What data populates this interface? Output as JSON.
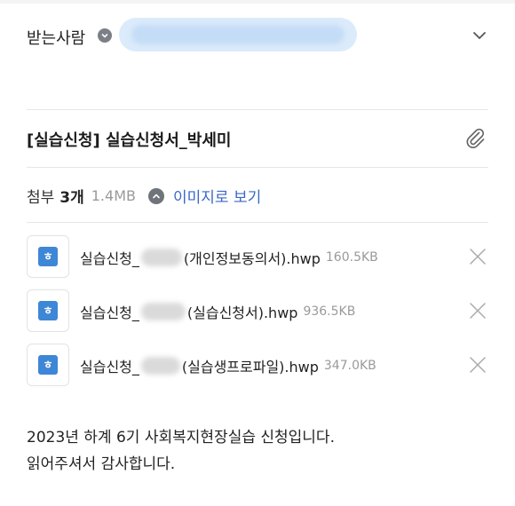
{
  "recipient": {
    "label": "받는사람",
    "info_icon": "info-circle-icon",
    "expand_icon": "chevron-down-icon"
  },
  "subject": {
    "text": "[실습신청] 실습신청서_박세미",
    "attach_icon": "paperclip-icon"
  },
  "attachments_summary": {
    "label": "첨부",
    "count": "3개",
    "total_size": "1.4MB",
    "collapse_icon": "chevron-up-circle-icon",
    "image_view_label": "이미지로 보기"
  },
  "attachments": [
    {
      "prefix": "실습신청_",
      "suffix": "(개인정보동의서).hwp",
      "size": "160.5KB",
      "icon": "hwp-file-icon",
      "icon_glyph": "ㅎ"
    },
    {
      "prefix": "실습신청_",
      "suffix": "(실습신청서).hwp",
      "size": "936.5KB",
      "icon": "hwp-file-icon",
      "icon_glyph": "ㅎ"
    },
    {
      "prefix": "실습신청_",
      "suffix": " (실습생프로파일).hwp",
      "size": "347.0KB",
      "icon": "hwp-file-icon",
      "icon_glyph": "ㅎ"
    }
  ],
  "body": {
    "line1": "2023년 하계 6기 사회복지현장실습 신청입니다.",
    "line2": "읽어주셔서 감사합니다."
  }
}
